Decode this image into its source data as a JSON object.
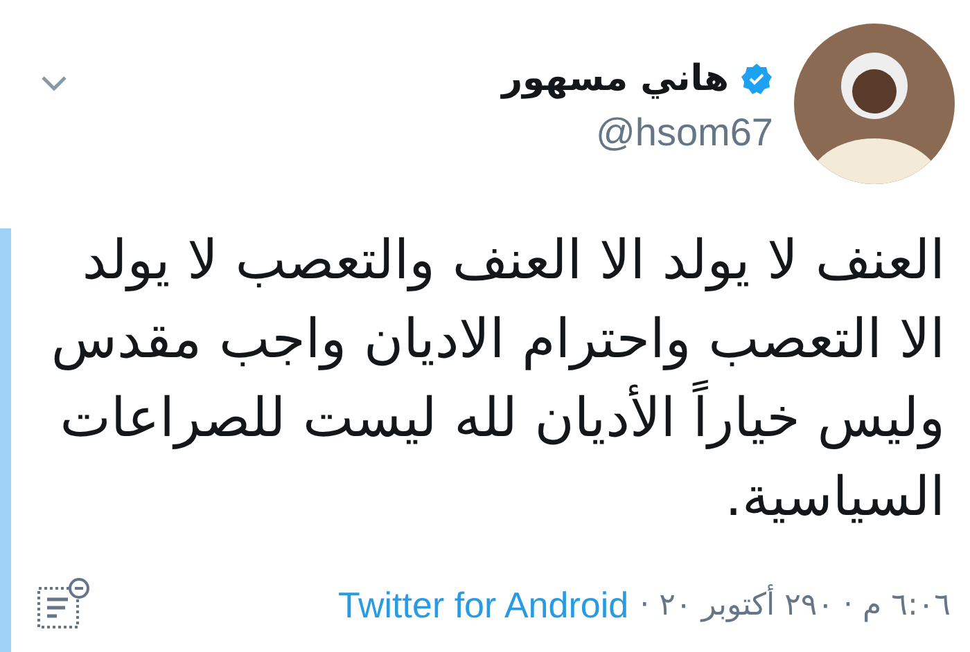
{
  "tweet": {
    "author": {
      "name": "هاني مسهور",
      "verified": true,
      "handle": "@hsom67"
    },
    "text": "العنف لا يولد الا العنف والتعصب لا يولد الا التعصب واحترام الاديان واجب مقدس وليس خياراً الأديان لله ليست للصراعات السياسية.",
    "timestamp": "٦:٠٦ م · ٢٩٠ أكتوبر ٢٠ ·",
    "source": "Twitter for Android"
  }
}
